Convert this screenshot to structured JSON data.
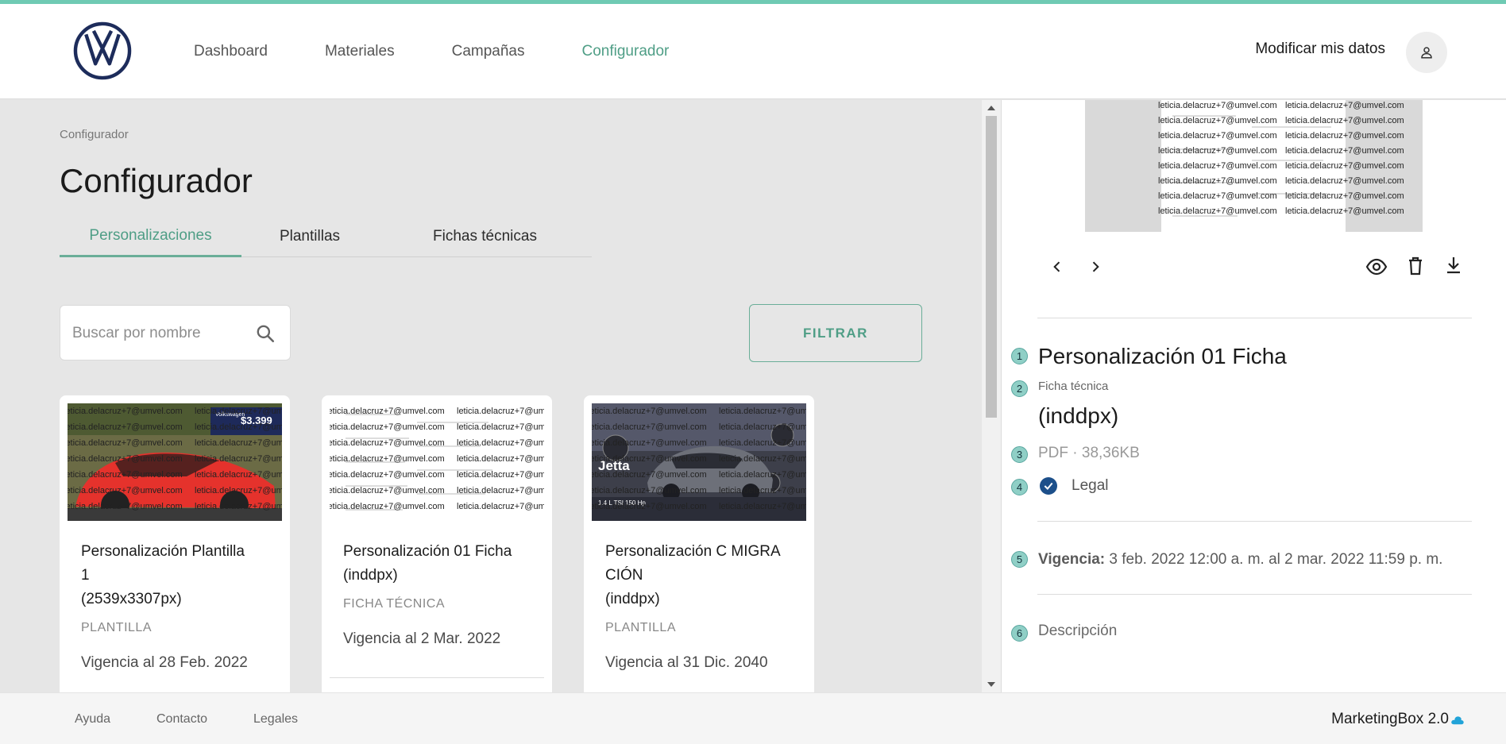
{
  "nav": {
    "items": [
      {
        "label": "Dashboard"
      },
      {
        "label": "Materiales"
      },
      {
        "label": "Campañas"
      },
      {
        "label": "Configurador"
      }
    ],
    "active": "Configurador",
    "modify_label": "Modificar mis datos"
  },
  "breadcrumb": "Configurador",
  "page_title": "Configurador",
  "tabs": [
    {
      "label": "Personalizaciones",
      "active": true
    },
    {
      "label": "Plantillas",
      "active": false
    },
    {
      "label": "Fichas técnicas",
      "active": false
    }
  ],
  "search": {
    "placeholder": "Buscar por nombre"
  },
  "filter_label": "FILTRAR",
  "cards": [
    {
      "title_line1": "Personalización Plantilla",
      "title_line2": "1",
      "title_line3": "(2539x3307px)",
      "type": "PLANTILLA",
      "validity": "Vigencia al 28 Feb. 2022",
      "thumb_texts": [
        "$3.399",
        "Volkswagen"
      ]
    },
    {
      "title_line1": "Personalización 01 Ficha",
      "title_line2": "(inddpx)",
      "type": "FICHA TÉCNICA",
      "validity": "Vigencia al 2 Mar. 2022"
    },
    {
      "title_line1": "Personalización C MIGRA",
      "title_line2": "CIÓN",
      "title_line3": "(inddpx)",
      "type": "PLANTILLA",
      "validity": "Vigencia al 31 Dic. 2040",
      "thumb_texts": [
        "Jetta",
        "1.4 L TSI",
        "150 Hp"
      ]
    }
  ],
  "watermark": "leticia.delacruz+7@umvel.com",
  "detail": {
    "title": "Personalización 01 Ficha",
    "type": "Ficha técnica",
    "subtitle": "(inddpx)",
    "meta": "PDF · 38,36KB",
    "legal": "Legal",
    "validity_label": "Vigencia:",
    "validity_value": "3 feb. 2022 12:00 a. m. al 2 mar. 2022 11:59 p. m.",
    "description_label": "Descripción",
    "steps": [
      "1",
      "2",
      "3",
      "4",
      "5",
      "6"
    ]
  },
  "footer": {
    "links": [
      "Ayuda",
      "Contacto",
      "Legales"
    ],
    "brand": "MarketingBox 2.0"
  },
  "colors": {
    "accent": "#4f9e86",
    "topline": "#6fcab3",
    "check": "#1c4f8a"
  }
}
